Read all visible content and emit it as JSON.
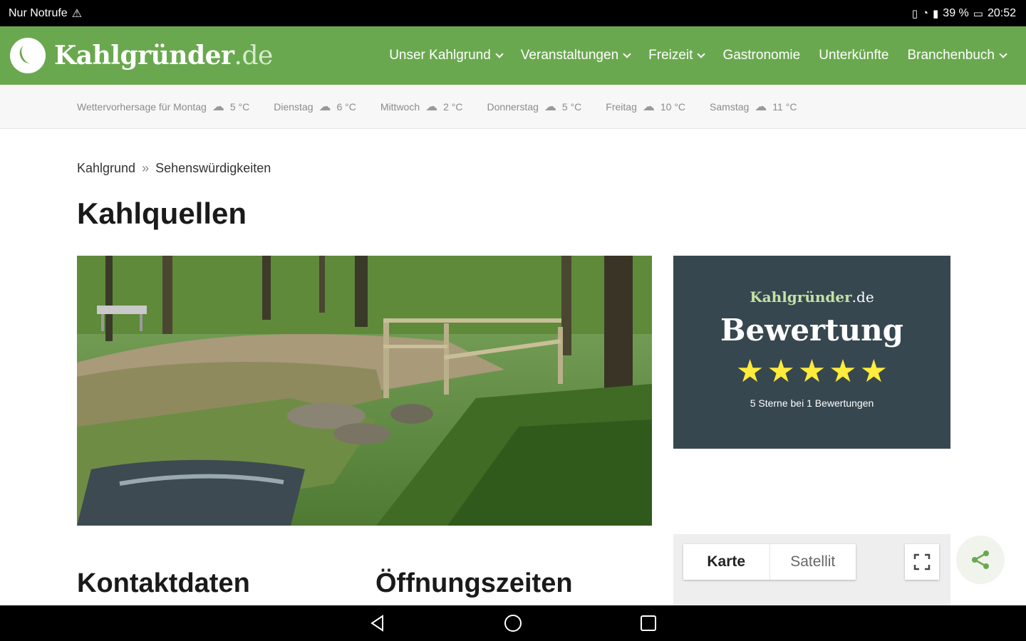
{
  "status_bar": {
    "left_text": "Nur Notrufe",
    "battery": "39 %",
    "time": "20:52"
  },
  "nav": {
    "logo_main": "Kahlgründer",
    "logo_tld": ".de",
    "menu": [
      {
        "label": "Unser Kahlgrund",
        "has_dropdown": true
      },
      {
        "label": "Veranstaltungen",
        "has_dropdown": true
      },
      {
        "label": "Freizeit",
        "has_dropdown": true
      },
      {
        "label": "Gastronomie",
        "has_dropdown": false
      },
      {
        "label": "Unterkünfte",
        "has_dropdown": false
      },
      {
        "label": "Branchenbuch",
        "has_dropdown": true
      }
    ]
  },
  "weather": {
    "days": [
      {
        "label": "Wettervorhersage für Montag",
        "temp": "5 °C",
        "icon": "cloud-rain-icon"
      },
      {
        "label": "Dienstag",
        "temp": "6 °C",
        "icon": "cloud-rain-icon"
      },
      {
        "label": "Mittwoch",
        "temp": "2 °C",
        "icon": "cloud-rain-icon"
      },
      {
        "label": "Donnerstag",
        "temp": "5 °C",
        "icon": "cloud-sun-icon"
      },
      {
        "label": "Freitag",
        "temp": "10 °C",
        "icon": "cloud-icon"
      },
      {
        "label": "Samstag",
        "temp": "11 °C",
        "icon": "cloud-icon"
      }
    ]
  },
  "breadcrumb": {
    "root": "Kahlgrund",
    "separator": "»",
    "current": "Sehenswürdigkeiten"
  },
  "page": {
    "title": "Kahlquellen"
  },
  "rating": {
    "brand_main": "Kahlgründer",
    "brand_tld": ".de",
    "title": "Bewertung",
    "stars": 5,
    "summary": "5 Sterne bei 1 Bewertungen",
    "star_color": "#ffeb3b"
  },
  "map": {
    "tab_map": "Karte",
    "tab_satellite": "Satellit"
  },
  "sections": {
    "contact": "Kontaktdaten",
    "hours": "Öffnungszeiten"
  },
  "colors": {
    "brand_green": "#6aa84f",
    "card_bg": "#37474f"
  }
}
